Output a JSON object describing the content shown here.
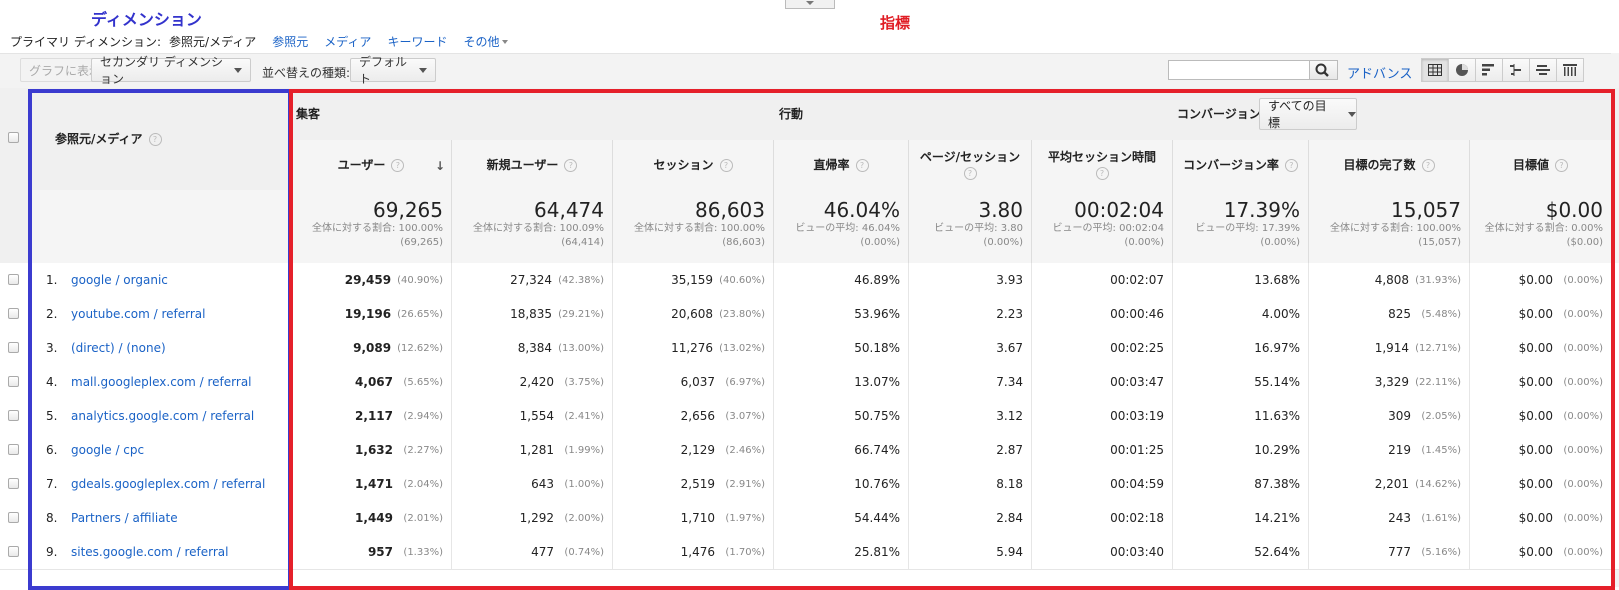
{
  "annotations": {
    "dimension": "ディメンション",
    "metrics": "指標"
  },
  "primary": {
    "label": "プライマリ ディメンション:",
    "current": "参照元/メディア",
    "links": [
      "参照元",
      "メディア",
      "キーワード",
      "その他"
    ]
  },
  "toolbar": {
    "plot_rows": "グラフに表示",
    "secondary_dim": "セカンダリ ディメンション",
    "sort_label": "並べ替えの種類:",
    "sort_value": "デフォルト",
    "search_placeholder": "",
    "advanced": "アドバンス"
  },
  "header": {
    "dimension_col": "参照元/メディア",
    "groups": {
      "acquisition": "集客",
      "behavior": "行動",
      "conversions": "コンバージョン"
    },
    "goal_select": "すべての目標",
    "columns": [
      "ユーザー",
      "新規ユーザー",
      "セッション",
      "直帰率",
      "ページ/セッション",
      "平均セッション時間",
      "コンバージョン率",
      "目標の完了数",
      "目標値"
    ]
  },
  "totals": [
    {
      "value": "69,265",
      "sub1": "全体に対する割合: 100.00%",
      "sub2": "(69,265)"
    },
    {
      "value": "64,474",
      "sub1": "全体に対する割合: 100.09%",
      "sub2": "(64,414)"
    },
    {
      "value": "86,603",
      "sub1": "全体に対する割合: 100.00%",
      "sub2": "(86,603)"
    },
    {
      "value": "46.04%",
      "sub1": "ビューの平均: 46.04%",
      "sub2": "(0.00%)"
    },
    {
      "value": "3.80",
      "sub1": "ビューの平均: 3.80",
      "sub2": "(0.00%)"
    },
    {
      "value": "00:02:04",
      "sub1": "ビューの平均: 00:02:04",
      "sub2": "(0.00%)"
    },
    {
      "value": "17.39%",
      "sub1": "ビューの平均: 17.39%",
      "sub2": "(0.00%)"
    },
    {
      "value": "15,057",
      "sub1": "全体に対する割合: 100.00%",
      "sub2": "(15,057)"
    },
    {
      "value": "$0.00",
      "sub1": "全体に対する割合: 0.00%",
      "sub2": "($0.00)"
    }
  ],
  "rows": [
    {
      "idx": "1.",
      "source": "google / organic",
      "cells": [
        [
          "29,459",
          "(40.90%)"
        ],
        [
          "27,324",
          "(42.38%)"
        ],
        [
          "35,159",
          "(40.60%)"
        ],
        [
          "46.89%",
          ""
        ],
        [
          "3.93",
          ""
        ],
        [
          "00:02:07",
          ""
        ],
        [
          "13.68%",
          ""
        ],
        [
          "4,808",
          "(31.93%)"
        ],
        [
          "$0.00",
          "(0.00%)"
        ]
      ]
    },
    {
      "idx": "2.",
      "source": "youtube.com / referral",
      "cells": [
        [
          "19,196",
          "(26.65%)"
        ],
        [
          "18,835",
          "(29.21%)"
        ],
        [
          "20,608",
          "(23.80%)"
        ],
        [
          "53.96%",
          ""
        ],
        [
          "2.23",
          ""
        ],
        [
          "00:00:46",
          ""
        ],
        [
          "4.00%",
          ""
        ],
        [
          "825",
          "(5.48%)"
        ],
        [
          "$0.00",
          "(0.00%)"
        ]
      ]
    },
    {
      "idx": "3.",
      "source": "(direct) / (none)",
      "cells": [
        [
          "9,089",
          "(12.62%)"
        ],
        [
          "8,384",
          "(13.00%)"
        ],
        [
          "11,276",
          "(13.02%)"
        ],
        [
          "50.18%",
          ""
        ],
        [
          "3.67",
          ""
        ],
        [
          "00:02:25",
          ""
        ],
        [
          "16.97%",
          ""
        ],
        [
          "1,914",
          "(12.71%)"
        ],
        [
          "$0.00",
          "(0.00%)"
        ]
      ]
    },
    {
      "idx": "4.",
      "source": "mall.googleplex.com / referral",
      "cells": [
        [
          "4,067",
          "(5.65%)"
        ],
        [
          "2,420",
          "(3.75%)"
        ],
        [
          "6,037",
          "(6.97%)"
        ],
        [
          "13.07%",
          ""
        ],
        [
          "7.34",
          ""
        ],
        [
          "00:03:47",
          ""
        ],
        [
          "55.14%",
          ""
        ],
        [
          "3,329",
          "(22.11%)"
        ],
        [
          "$0.00",
          "(0.00%)"
        ]
      ]
    },
    {
      "idx": "5.",
      "source": "analytics.google.com / referral",
      "cells": [
        [
          "2,117",
          "(2.94%)"
        ],
        [
          "1,554",
          "(2.41%)"
        ],
        [
          "2,656",
          "(3.07%)"
        ],
        [
          "50.75%",
          ""
        ],
        [
          "3.12",
          ""
        ],
        [
          "00:03:19",
          ""
        ],
        [
          "11.63%",
          ""
        ],
        [
          "309",
          "(2.05%)"
        ],
        [
          "$0.00",
          "(0.00%)"
        ]
      ]
    },
    {
      "idx": "6.",
      "source": "google / cpc",
      "cells": [
        [
          "1,632",
          "(2.27%)"
        ],
        [
          "1,281",
          "(1.99%)"
        ],
        [
          "2,129",
          "(2.46%)"
        ],
        [
          "66.74%",
          ""
        ],
        [
          "2.87",
          ""
        ],
        [
          "00:01:25",
          ""
        ],
        [
          "10.29%",
          ""
        ],
        [
          "219",
          "(1.45%)"
        ],
        [
          "$0.00",
          "(0.00%)"
        ]
      ]
    },
    {
      "idx": "7.",
      "source": "gdeals.googleplex.com / referral",
      "cells": [
        [
          "1,471",
          "(2.04%)"
        ],
        [
          "643",
          "(1.00%)"
        ],
        [
          "2,519",
          "(2.91%)"
        ],
        [
          "10.76%",
          ""
        ],
        [
          "8.18",
          ""
        ],
        [
          "00:04:59",
          ""
        ],
        [
          "87.38%",
          ""
        ],
        [
          "2,201",
          "(14.62%)"
        ],
        [
          "$0.00",
          "(0.00%)"
        ]
      ]
    },
    {
      "idx": "8.",
      "source": "Partners / affiliate",
      "cells": [
        [
          "1,449",
          "(2.01%)"
        ],
        [
          "1,292",
          "(2.00%)"
        ],
        [
          "1,710",
          "(1.97%)"
        ],
        [
          "54.44%",
          ""
        ],
        [
          "2.84",
          ""
        ],
        [
          "00:02:18",
          ""
        ],
        [
          "14.21%",
          ""
        ],
        [
          "243",
          "(1.61%)"
        ],
        [
          "$0.00",
          "(0.00%)"
        ]
      ]
    },
    {
      "idx": "9.",
      "source": "sites.google.com / referral",
      "cells": [
        [
          "957",
          "(1.33%)"
        ],
        [
          "477",
          "(0.74%)"
        ],
        [
          "1,476",
          "(1.70%)"
        ],
        [
          "25.81%",
          ""
        ],
        [
          "5.94",
          ""
        ],
        [
          "00:03:40",
          ""
        ],
        [
          "52.64%",
          ""
        ],
        [
          "777",
          "(5.16%)"
        ],
        [
          "$0.00",
          "(0.00%)"
        ]
      ]
    }
  ]
}
